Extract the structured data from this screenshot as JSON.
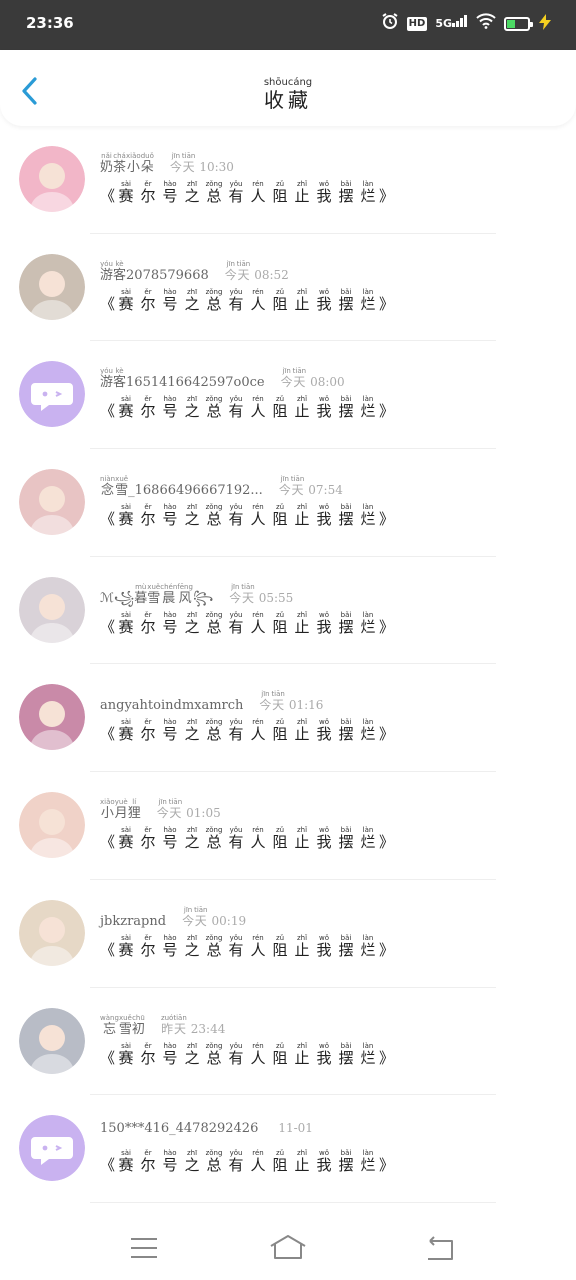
{
  "status": {
    "time": "23:36",
    "hd": "HD",
    "net": "5G"
  },
  "header": {
    "title_pinyin": "shōucáng",
    "title": "收藏"
  },
  "message": {
    "open": "《",
    "close": "》",
    "chars": [
      {
        "c": "赛",
        "p": "sài"
      },
      {
        "c": "尔",
        "p": "ěr"
      },
      {
        "c": "号",
        "p": "hào"
      },
      {
        "c": "之",
        "p": "zhī"
      },
      {
        "c": "总",
        "p": "zǒng"
      },
      {
        "c": "有",
        "p": "yǒu"
      },
      {
        "c": "人",
        "p": "rén"
      },
      {
        "c": "阻",
        "p": "zǔ"
      },
      {
        "c": "止",
        "p": "zhǐ"
      },
      {
        "c": "我",
        "p": "wǒ"
      },
      {
        "c": "摆",
        "p": "bǎi"
      },
      {
        "c": "烂",
        "p": "làn"
      }
    ]
  },
  "favorites": [
    {
      "name_prefix": "",
      "name_ruby": [
        {
          "c": "奶",
          "p": "nǎi"
        },
        {
          "c": "茶",
          "p": "chá"
        },
        {
          "c": "小",
          "p": "xiǎo"
        },
        {
          "c": "朵",
          "p": "duǒ"
        }
      ],
      "name_suffix": "",
      "time_ruby": [
        {
          "c": "今",
          "p": "jīn"
        },
        {
          "c": "天",
          "p": "tiān"
        }
      ],
      "time": "10:30",
      "avatar_color": "#f2b6c8",
      "avatar_type": "photo"
    },
    {
      "name_prefix": "",
      "name_ruby": [
        {
          "c": "游",
          "p": "yóu"
        },
        {
          "c": "客",
          "p": "kè"
        }
      ],
      "name_suffix": "2078579668",
      "time_ruby": [
        {
          "c": "今",
          "p": "jīn"
        },
        {
          "c": "天",
          "p": "tiān"
        }
      ],
      "time": "08:52",
      "avatar_color": "#cbbfb3",
      "avatar_type": "photo"
    },
    {
      "name_prefix": "",
      "name_ruby": [
        {
          "c": "游",
          "p": "yóu"
        },
        {
          "c": "客",
          "p": "kè"
        }
      ],
      "name_suffix": "1651416642597o0ce",
      "time_ruby": [
        {
          "c": "今",
          "p": "jīn"
        },
        {
          "c": "天",
          "p": "tiān"
        }
      ],
      "time": "08:00",
      "avatar_color": "#c9b2f0",
      "avatar_type": "chat"
    },
    {
      "name_prefix": "",
      "name_ruby": [
        {
          "c": "念",
          "p": "niàn"
        },
        {
          "c": "雪",
          "p": "xuě"
        }
      ],
      "name_suffix": "_16866496667192...",
      "time_ruby": [
        {
          "c": "今",
          "p": "jīn"
        },
        {
          "c": "天",
          "p": "tiān"
        }
      ],
      "time": "07:54",
      "avatar_color": "#e8c4c4",
      "avatar_type": "photo"
    },
    {
      "name_prefix": "ℳ꧁",
      "name_ruby": [
        {
          "c": "暮",
          "p": "mù"
        },
        {
          "c": "雪",
          "p": "xuě"
        },
        {
          "c": "晨",
          "p": "chén"
        },
        {
          "c": "风",
          "p": "fēng"
        }
      ],
      "name_suffix": "꧂",
      "time_ruby": [
        {
          "c": "今",
          "p": "jīn"
        },
        {
          "c": "天",
          "p": "tiān"
        }
      ],
      "time": "05:55",
      "avatar_color": "#d9d2d8",
      "avatar_type": "photo"
    },
    {
      "name_prefix": "angyahtoindmxamrch",
      "name_ruby": [],
      "name_suffix": "",
      "time_ruby": [
        {
          "c": "今",
          "p": "jīn"
        },
        {
          "c": "天",
          "p": "tiān"
        }
      ],
      "time": "01:16",
      "avatar_color": "#c98aa8",
      "avatar_type": "photo"
    },
    {
      "name_prefix": "",
      "name_ruby": [
        {
          "c": "小",
          "p": "xiǎo"
        },
        {
          "c": "月",
          "p": "yuè"
        },
        {
          "c": "狸",
          "p": "lí"
        }
      ],
      "name_suffix": "",
      "time_ruby": [
        {
          "c": "今",
          "p": "jīn"
        },
        {
          "c": "天",
          "p": "tiān"
        }
      ],
      "time": "01:05",
      "avatar_color": "#f0d2c8",
      "avatar_type": "photo"
    },
    {
      "name_prefix": "jbkzrapnd",
      "name_ruby": [],
      "name_suffix": "",
      "time_ruby": [
        {
          "c": "今",
          "p": "jīn"
        },
        {
          "c": "天",
          "p": "tiān"
        }
      ],
      "time": "00:19",
      "avatar_color": "#e6d8c6",
      "avatar_type": "photo"
    },
    {
      "name_prefix": "",
      "name_ruby": [
        {
          "c": "忘",
          "p": "wàng"
        },
        {
          "c": "雪",
          "p": "xuě"
        },
        {
          "c": "初",
          "p": "chū"
        }
      ],
      "name_suffix": "",
      "time_ruby": [
        {
          "c": "昨",
          "p": "zuó"
        },
        {
          "c": "天",
          "p": "tiān"
        }
      ],
      "time": "23:44",
      "avatar_color": "#b8bcc6",
      "avatar_type": "photo"
    },
    {
      "name_prefix": "150***416_4478292426",
      "name_ruby": [],
      "name_suffix": "",
      "time_ruby": [],
      "time": "11-01",
      "avatar_color": "#c9b2f0",
      "avatar_type": "chat"
    }
  ]
}
